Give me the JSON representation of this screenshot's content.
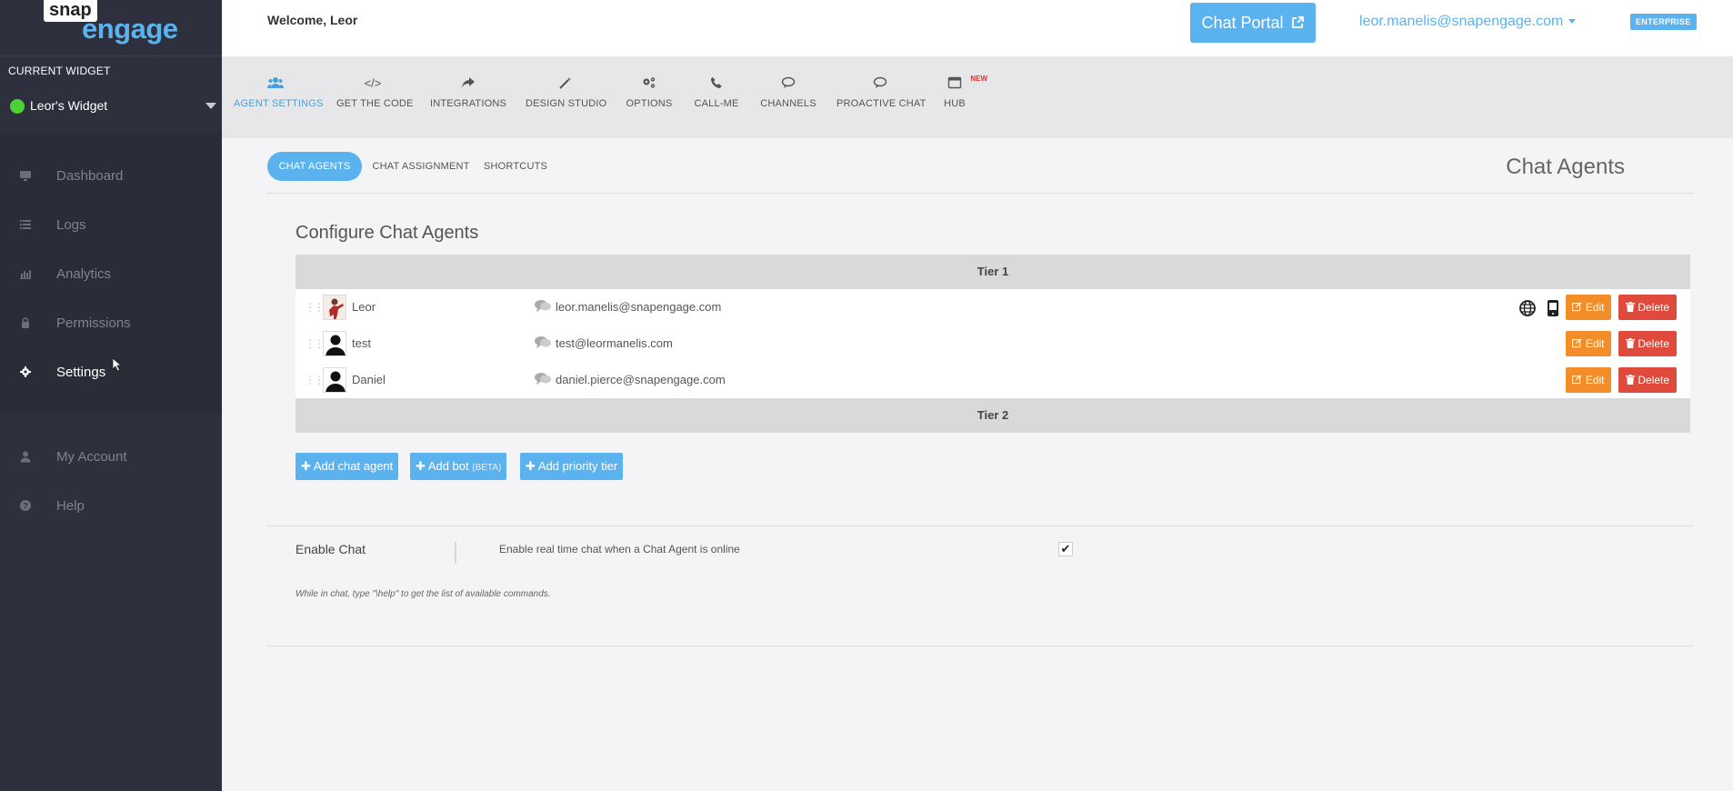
{
  "logo": {
    "snap": "snap",
    "engage": "engage"
  },
  "sidebar": {
    "current_widget_label": "CURRENT WIDGET",
    "widget_name": "Leor's Widget",
    "widget_status_color": "#4cd137",
    "nav": [
      {
        "label": "Dashboard",
        "icon": "monitor-icon"
      },
      {
        "label": "Logs",
        "icon": "list-icon"
      },
      {
        "label": "Analytics",
        "icon": "bar-chart-icon"
      },
      {
        "label": "Permissions",
        "icon": "lock-icon"
      },
      {
        "label": "Settings",
        "icon": "gear-icon",
        "active": true
      }
    ],
    "nav_bottom": [
      {
        "label": "My Account",
        "icon": "user-icon"
      },
      {
        "label": "Help",
        "icon": "help-icon"
      }
    ]
  },
  "header": {
    "welcome": "Welcome, Leor",
    "chat_portal": "Chat Portal",
    "user_email": "leor.manelis@snapengage.com",
    "plan_badge": "ENTERPRISE"
  },
  "tabs": [
    {
      "label": "AGENT SETTINGS",
      "icon": "users-icon",
      "active": true
    },
    {
      "label": "GET THE CODE",
      "icon": "code-icon"
    },
    {
      "label": "INTEGRATIONS",
      "icon": "share-icon"
    },
    {
      "label": "DESIGN STUDIO",
      "icon": "magic-wand-icon"
    },
    {
      "label": "OPTIONS",
      "icon": "cogs-icon"
    },
    {
      "label": "CALL-ME",
      "icon": "phone-icon"
    },
    {
      "label": "CHANNELS",
      "icon": "comment-icon"
    },
    {
      "label": "PROACTIVE CHAT",
      "icon": "chat-bubble-icon"
    },
    {
      "label": "HUB",
      "icon": "window-icon",
      "badge": "NEW"
    }
  ],
  "subtabs": [
    {
      "label": "CHAT AGENTS",
      "active": true
    },
    {
      "label": "CHAT ASSIGNMENT"
    },
    {
      "label": "SHORTCUTS"
    }
  ],
  "section_title": "Chat Agents",
  "configure_title": "Configure Chat Agents",
  "tiers": [
    {
      "label": "Tier 1",
      "agents": [
        {
          "name": "Leor",
          "email": "leor.manelis@snapengage.com",
          "extra_icons": true
        },
        {
          "name": "test",
          "email": "test@leormanelis.com",
          "extra_icons": false
        },
        {
          "name": "Daniel",
          "email": "daniel.pierce@snapengage.com",
          "extra_icons": false
        }
      ]
    },
    {
      "label": "Tier 2",
      "agents": []
    }
  ],
  "row_actions": {
    "edit": "Edit",
    "delete": "Delete"
  },
  "add_buttons": {
    "agent": "Add chat agent",
    "bot": "Add bot",
    "bot_beta": "(BETA)",
    "tier": "Add priority tier"
  },
  "enable_chat": {
    "label": "Enable Chat",
    "description": "Enable real time chat when a Chat Agent is online",
    "checked": true,
    "note": "While in chat, type \"\\help\" to get the list of available commands."
  },
  "colors": {
    "accent": "#5ab2ee",
    "edit": "#f28d2a",
    "delete": "#e04a3c",
    "sidebar": "#2e313d"
  }
}
